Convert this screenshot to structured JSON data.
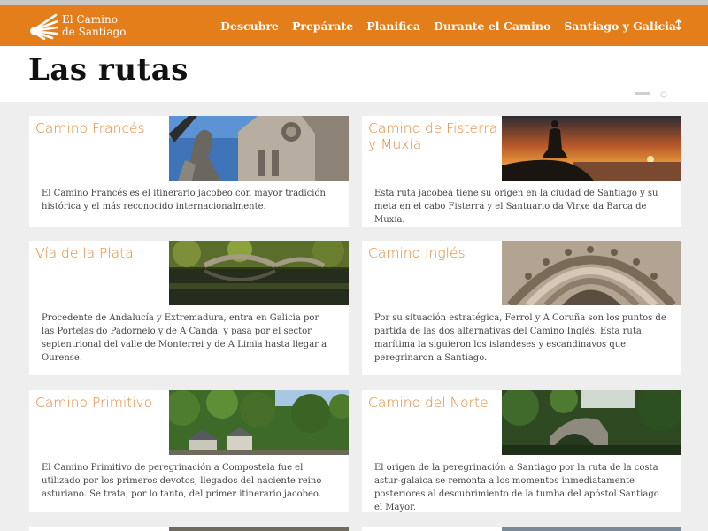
{
  "brand": {
    "line1": "El Camino",
    "line2": "de Santiago"
  },
  "nav": {
    "items": [
      "Descubre",
      "Prepárate",
      "Planifica",
      "Durante el Camino",
      "Santiago y Galicia"
    ],
    "toggle": "↕"
  },
  "page": {
    "title": "Las rutas"
  },
  "colors": {
    "accent": "#e47e1a",
    "card_title": "#e08a3c",
    "background": "#eeeeee"
  },
  "routes": [
    {
      "title": "Camino Francés",
      "image": "cathedral-statue-photo",
      "text": "El Camino Francés es el itinerario jacobeo con mayor tradición histórica y el más reconocido internacionalmente."
    },
    {
      "title": "Camino de Fisterra y Muxía",
      "image": "sunset-meditation-photo",
      "text": "Esta ruta jacobea tiene su origen en la ciudad de Santiago y su meta en el cabo Fisterra y el Santuario da Virxe da Barca de Muxía."
    },
    {
      "title": "Vía de la Plata",
      "image": "river-bridge-photo",
      "text": "Procedente de Andalucía y Extremadura, entra en Galicia por las Portelas do Padornelo y de A Canda, y pasa por el sector septentrional del valle de Monterrei y de A Limia hasta llegar a Ourense."
    },
    {
      "title": "Camino Inglés",
      "image": "stone-carving-photo",
      "text": "Por su situación estratégica, Ferrol y A Coruña son los puntos de partida de las dos alternativas del Camino Inglés. Esta ruta marítima la siguieron los islandeses y escandinavos que peregrinaron a Santiago."
    },
    {
      "title": "Camino Primitivo",
      "image": "village-forest-photo",
      "text": "El Camino Primitivo de peregrinación a Compostela fue el utilizado por los primeros devotos, llegados del naciente reino asturiano. Se trata, por lo tanto, del primer itinerario jacobeo."
    },
    {
      "title": "Camino del Norte",
      "image": "stone-bridge-photo",
      "text": "El origen de la peregrinación a Santiago por la ruta de la costa astur-galaica se remonta a los momentos inmediatamente posteriores al descubrimiento de la tumba del apóstol Santiago el Mayor."
    }
  ]
}
